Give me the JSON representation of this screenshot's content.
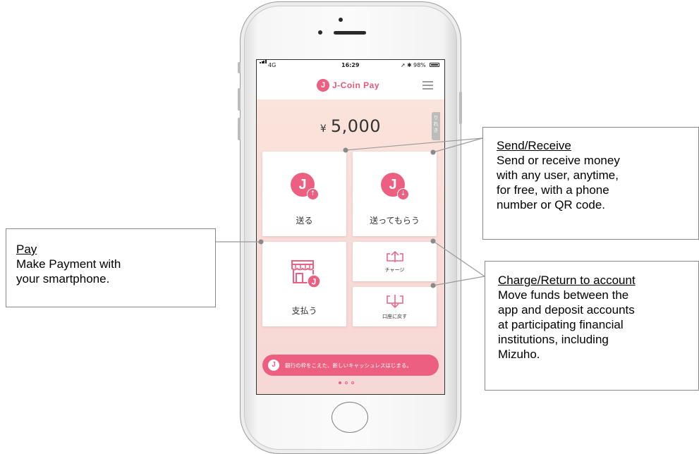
{
  "status_bar": {
    "carrier": "4G",
    "time": "16:29",
    "battery": "98%"
  },
  "app": {
    "logo_letter": "J",
    "title": "J-Coin Pay"
  },
  "balance": {
    "currency": "¥",
    "amount": "5,000"
  },
  "history_tab": "りれき",
  "tiles": {
    "send": {
      "label": "送る",
      "icon_letter": "J"
    },
    "receive": {
      "label": "送ってもらう",
      "icon_letter": "J"
    },
    "pay": {
      "label": "支払う"
    },
    "charge": {
      "label": "チャージ"
    },
    "return": {
      "label": "口座に戻す"
    }
  },
  "banner": {
    "logo_letter": "J",
    "text": "銀行の枠をこえた、新しいキャッシュレスはじまる。"
  },
  "callouts": {
    "send_receive": {
      "title": "Send/Receive",
      "lines": [
        "Send or receive money",
        "with any user, anytime,",
        "for free, with a phone",
        "number or QR code."
      ]
    },
    "pay": {
      "title": "Pay",
      "lines": [
        "Make Payment with",
        "your smartphone."
      ]
    },
    "charge_return": {
      "title": "Charge/Return to account",
      "lines": [
        "Move funds between the",
        "app and deposit accounts",
        "at participating financial",
        "institutions, including",
        "Mizuho."
      ]
    }
  },
  "colors": {
    "brand_pink": "#ec5f80",
    "background_peach": "#f8dcd7"
  },
  "icons": [
    "signal-icon",
    "location-icon",
    "bluetooth-icon",
    "battery-icon",
    "menu-icon",
    "arrow-up-icon",
    "arrow-down-icon",
    "shop-icon",
    "charge-icon",
    "return-icon"
  ]
}
